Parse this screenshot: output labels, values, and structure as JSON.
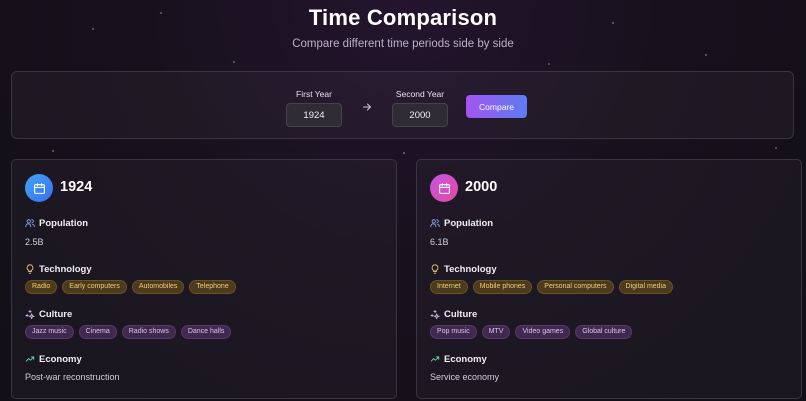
{
  "header": {
    "title": "Time Comparison",
    "subtitle": "Compare different time periods side by side"
  },
  "controls": {
    "first_year_label": "First Year",
    "first_year_value": "1924",
    "second_year_label": "Second Year",
    "second_year_value": "2000",
    "compare_label": "Compare"
  },
  "sections": {
    "population": "Population",
    "technology": "Technology",
    "culture": "Culture",
    "economy": "Economy"
  },
  "cards": [
    {
      "year": "1924",
      "population": "2.5B",
      "technology": [
        "Radio",
        "Early computers",
        "Automobiles",
        "Telephone"
      ],
      "culture": [
        "Jazz music",
        "Cinema",
        "Radio shows",
        "Dance halls"
      ],
      "economy": "Post-war reconstruction"
    },
    {
      "year": "2000",
      "population": "6.1B",
      "technology": [
        "Internet",
        "Mobile phones",
        "Personal computers",
        "Digital media"
      ],
      "culture": [
        "Pop music",
        "MTV",
        "Video games",
        "Global culture"
      ],
      "economy": "Service economy"
    }
  ],
  "colors": {
    "accent_gradient_start": "#a455f0",
    "accent_gradient_end": "#5b7cf4",
    "card1_icon": "#3b82f6",
    "card2_icon": "#d946ef",
    "tech_tag": "#f3cf77",
    "culture_tag": "#dcc4f1"
  },
  "icons": {
    "card_icon": "calendar-icon",
    "population": "users-icon",
    "technology": "lightbulb-icon",
    "culture": "sparkles-icon",
    "economy": "trending-up-icon",
    "between_years": "arrow-right-icon"
  }
}
